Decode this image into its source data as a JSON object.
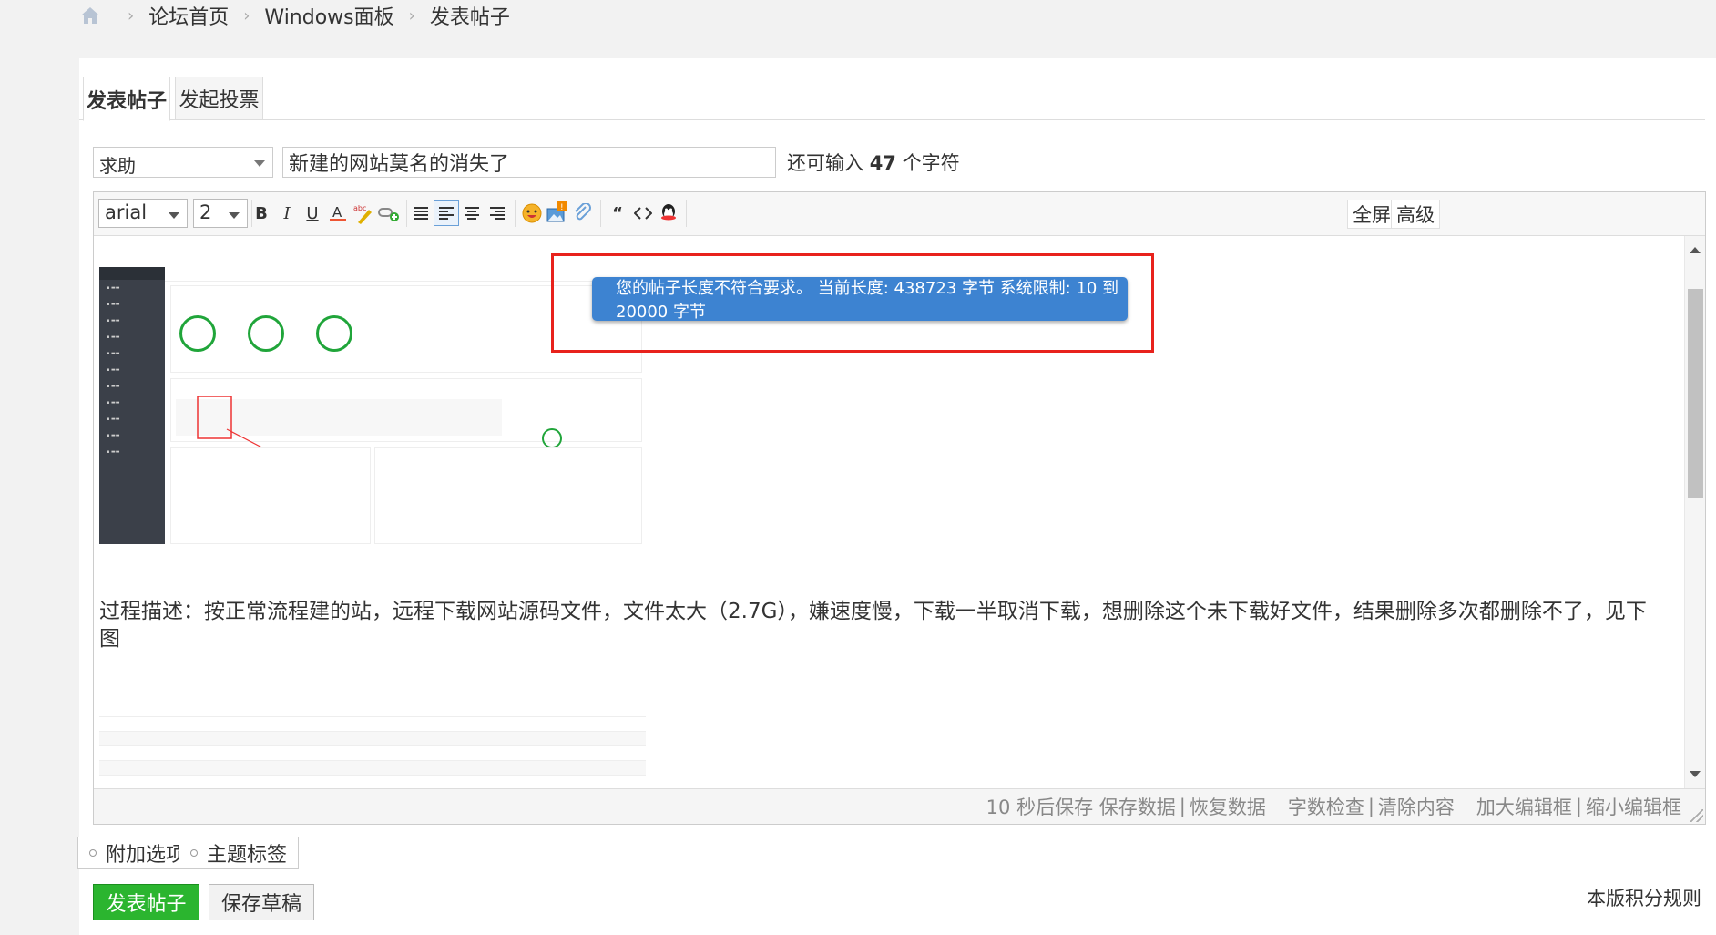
{
  "breadcrumb": {
    "items": [
      "论坛首页",
      "Windows面板",
      "发表帖子"
    ]
  },
  "tabs": [
    "发表帖子",
    "发起投票"
  ],
  "post": {
    "type_value": "求助",
    "title_value": "新建的网站莫名的消失了",
    "remain_prefix": "还可输入",
    "remain_count": "47",
    "remain_suffix": "个字符"
  },
  "toolbar": {
    "font_family": "arial",
    "font_size": "2",
    "fullscreen_label": "全屏",
    "advanced_label": "高级"
  },
  "toast": {
    "message": "您的帖子长度不符合要求。 当前长度: 438723 字节 系统限制: 10 到 20000 字节"
  },
  "content": {
    "description": "过程描述：按正常流程建的站，远程下载网站源码文件，文件太大（2.7G），嫌速度慢，下载一半取消下载，想删除这个未下载好文件，结果删除多次都删除不了，见下图"
  },
  "statusbar": {
    "autosave": "10 秒后保存",
    "save_data": "保存数据",
    "restore_data": "恢复数据",
    "word_check": "字数检查",
    "clear_content": "清除内容",
    "enlarge": "加大编辑框",
    "shrink": "缩小编辑框",
    "divider": "|"
  },
  "options": {
    "extra": "附加选项",
    "tags": "主题标签"
  },
  "actions": {
    "submit": "发表帖子",
    "draft": "保存草稿",
    "rules": "本版积分规则"
  },
  "colors": {
    "submit_green": "#2bb52f",
    "toast_blue": "#3d83d1",
    "highlight_red": "#e8221c"
  }
}
